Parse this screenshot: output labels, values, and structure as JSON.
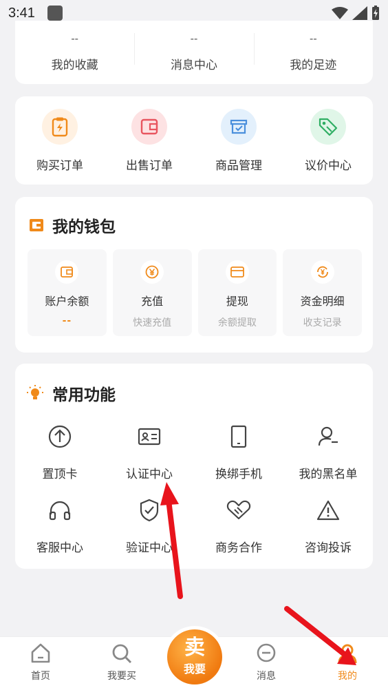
{
  "status_bar": {
    "time": "3:41"
  },
  "stats": [
    {
      "value": "--",
      "label": "我的收藏"
    },
    {
      "value": "--",
      "label": "消息中心"
    },
    {
      "value": "--",
      "label": "我的足迹"
    }
  ],
  "orders": [
    {
      "label": "购买订单",
      "icon": "clipboard-icon"
    },
    {
      "label": "出售订单",
      "icon": "wallet-icon"
    },
    {
      "label": "商品管理",
      "icon": "box-icon"
    },
    {
      "label": "议价中心",
      "icon": "tag-icon"
    }
  ],
  "wallet": {
    "title": "我的钱包",
    "items": [
      {
        "label": "账户余额",
        "sub": "--"
      },
      {
        "label": "充值",
        "sub": "快速充值"
      },
      {
        "label": "提现",
        "sub": "余额提取"
      },
      {
        "label": "资金明细",
        "sub": "收支记录"
      }
    ]
  },
  "functions": {
    "title": "常用功能",
    "items": [
      {
        "label": "置顶卡",
        "icon": "arrow-up-circle-icon"
      },
      {
        "label": "认证中心",
        "icon": "id-card-icon"
      },
      {
        "label": "换绑手机",
        "icon": "phone-icon"
      },
      {
        "label": "我的黑名单",
        "icon": "user-minus-icon"
      },
      {
        "label": "客服中心",
        "icon": "headphones-icon"
      },
      {
        "label": "验证中心",
        "icon": "shield-check-icon"
      },
      {
        "label": "商务合作",
        "icon": "handshake-icon"
      },
      {
        "label": "咨询投诉",
        "icon": "warning-icon"
      }
    ]
  },
  "tabbar": {
    "home": "首页",
    "buy": "我要买",
    "sell_big": "卖",
    "sell_small": "我要",
    "messages": "消息",
    "mine": "我的"
  },
  "colors": {
    "accent": "#f08a1a",
    "annotation": "#e8141c"
  }
}
